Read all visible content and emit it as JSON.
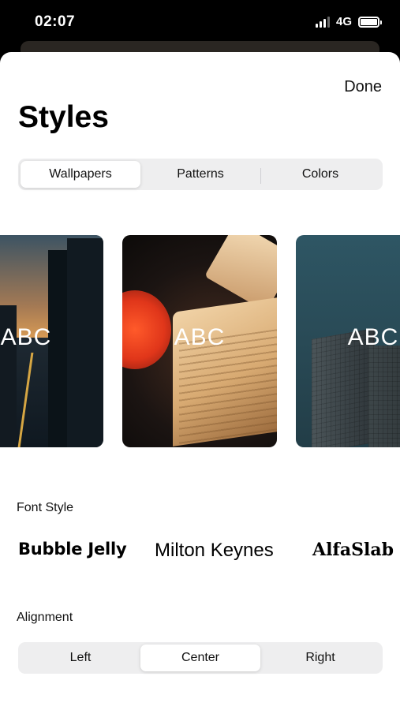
{
  "status_bar": {
    "time": "02:07",
    "network": "4G"
  },
  "sheet": {
    "done_label": "Done",
    "title": "Styles"
  },
  "tabs": {
    "items": [
      "Wallpapers",
      "Patterns",
      "Colors"
    ],
    "active": "Wallpapers"
  },
  "wallpapers": {
    "cards": [
      {
        "label": "ABC",
        "scene": "city-street"
      },
      {
        "label": "ABC",
        "scene": "open-book-flower"
      },
      {
        "label": "ABC",
        "scene": "architecture-teal"
      }
    ]
  },
  "font_style": {
    "label": "Font Style",
    "options": [
      "Bubble Jelly",
      "Milton Keynes",
      "AlfaSlab"
    ]
  },
  "alignment": {
    "label": "Alignment",
    "options": [
      "Left",
      "Center",
      "Right"
    ],
    "active": "Center"
  },
  "colors": {
    "accent_text": "#111111",
    "segment_bg": "#eeeeef",
    "sheet_bg": "#ffffff"
  },
  "icons": [
    "signal-icon",
    "battery-icon"
  ]
}
